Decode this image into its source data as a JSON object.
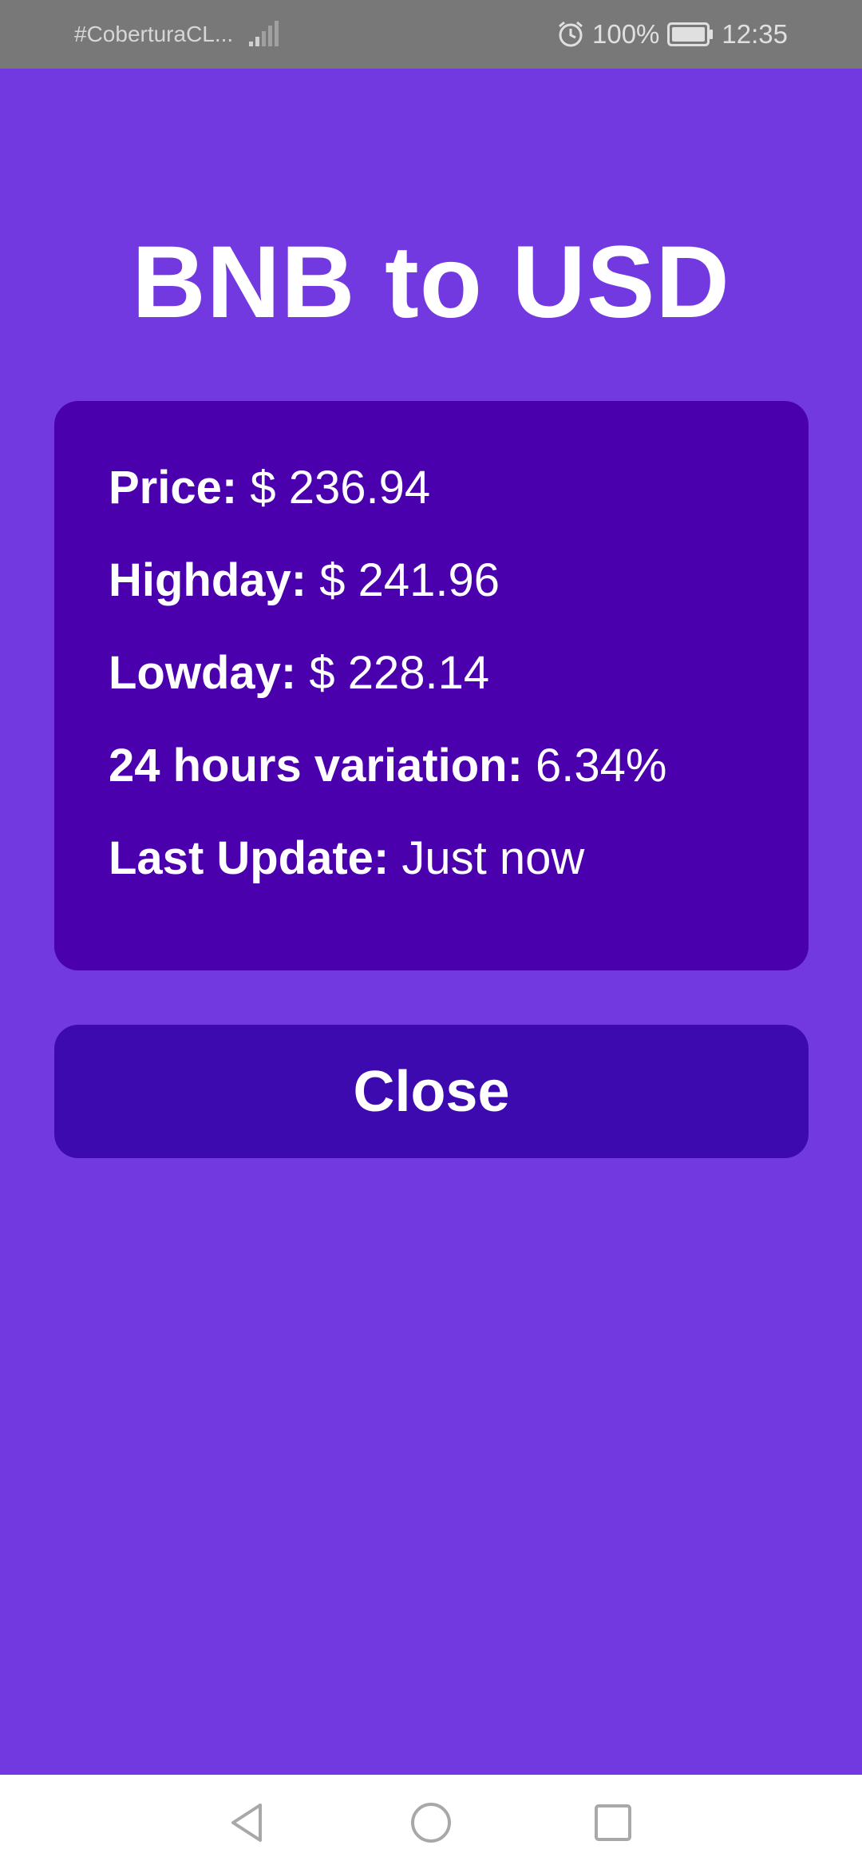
{
  "status_bar": {
    "carrier": "#CoberturaCL...",
    "battery_percent": "100%",
    "time": "12:35",
    "icons": [
      "signal-icon",
      "alarm-icon",
      "battery-icon"
    ]
  },
  "title": "BNB to USD",
  "info": {
    "rows": [
      {
        "label": "Price:",
        "value": "$ 236.94"
      },
      {
        "label": "Highday:",
        "value": "$ 241.96"
      },
      {
        "label": "Lowday:",
        "value": "$ 228.14"
      },
      {
        "label": "24 hours variation:",
        "value": "6.34%"
      },
      {
        "label": "Last Update:",
        "value": "Just now"
      }
    ]
  },
  "close_button": {
    "label": "Close"
  },
  "nav_bar": {
    "icons": [
      "back-icon",
      "home-icon",
      "recent-apps-icon"
    ]
  },
  "colors": {
    "background": "#7339E0",
    "card": "#4B00AE",
    "button": "#3C0AAF",
    "text": "#FFFFFF",
    "status_bar": "#787878"
  }
}
